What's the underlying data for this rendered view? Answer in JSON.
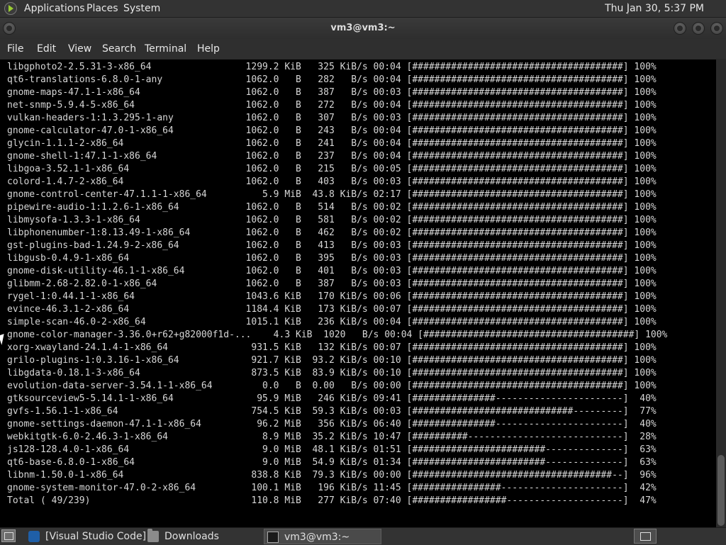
{
  "top_panel": {
    "logo_icon": "distro-logo-icon",
    "menus": [
      "Applications",
      "Places",
      "System"
    ],
    "clock": "Thu Jan 30,  5:37 PM"
  },
  "window": {
    "title": "vm3@vm3:~",
    "controls": [
      "minimize-icon",
      "maximize-icon",
      "close-icon"
    ]
  },
  "menubar": [
    "File",
    "Edit",
    "View",
    "Search",
    "Terminal",
    "Help"
  ],
  "terminal": {
    "lines": [
      "libgphoto2-2.5.31-3-x86_64                 1299.2 KiB   325 KiB/s 00:04 [######################################] 100%",
      "qt6-translations-6.8.0-1-any               1062.0   B   282   B/s 00:04 [######################################] 100%",
      "gnome-maps-47.1-1-x86_64                   1062.0   B   387   B/s 00:03 [######################################] 100%",
      "net-snmp-5.9.4-5-x86_64                    1062.0   B   272   B/s 00:04 [######################################] 100%",
      "vulkan-headers-1:1.3.295-1-any             1062.0   B   307   B/s 00:03 [######################################] 100%",
      "gnome-calculator-47.0-1-x86_64             1062.0   B   243   B/s 00:04 [######################################] 100%",
      "glycin-1.1.1-2-x86_64                      1062.0   B   241   B/s 00:04 [######################################] 100%",
      "gnome-shell-1:47.1-1-x86_64                1062.0   B   237   B/s 00:04 [######################################] 100%",
      "libgoa-3.52.1-1-x86_64                     1062.0   B   215   B/s 00:05 [######################################] 100%",
      "colord-1.4.7-2-x86_64                      1062.0   B   403   B/s 00:03 [######################################] 100%",
      "gnome-control-center-47.1.1-1-x86_64          5.9 MiB  43.8 KiB/s 02:17 [######################################] 100%",
      "pipewire-audio-1:1.2.6-1-x86_64            1062.0   B   514   B/s 00:02 [######################################] 100%",
      "libmysofa-1.3.3-1-x86_64                   1062.0   B   581   B/s 00:02 [######################################] 100%",
      "libphonenumber-1:8.13.49-1-x86_64          1062.0   B   462   B/s 00:02 [######################################] 100%",
      "gst-plugins-bad-1.24.9-2-x86_64            1062.0   B   413   B/s 00:03 [######################################] 100%",
      "libgusb-0.4.9-1-x86_64                     1062.0   B   395   B/s 00:03 [######################################] 100%",
      "gnome-disk-utility-46.1-1-x86_64           1062.0   B   401   B/s 00:03 [######################################] 100%",
      "glibmm-2.68-2.82.0-1-x86_64                1062.0   B   387   B/s 00:03 [######################################] 100%",
      "rygel-1:0.44.1-1-x86_64                    1043.6 KiB   170 KiB/s 00:06 [######################################] 100%",
      "evince-46.3.1-2-x86_64                     1184.4 KiB   173 KiB/s 00:07 [######################################] 100%",
      "simple-scan-46.0-2-x86_64                  1015.1 KiB   236 KiB/s 00:04 [######################################] 100%",
      "gnome-color-manager-3.36.0+r62+g82000f1d-...    4.3 KiB  1020   B/s 00:04 [######################################] 100%",
      "xorg-xwayland-24.1.4-1-x86_64               931.5 KiB   132 KiB/s 00:07 [######################################] 100%",
      "grilo-plugins-1:0.3.16-1-x86_64             921.7 KiB  93.2 KiB/s 00:10 [######################################] 100%",
      "libgdata-0.18.1-3-x86_64                    873.5 KiB  83.9 KiB/s 00:10 [######################################] 100%",
      "evolution-data-server-3.54.1-1-x86_64         0.0   B  0.00   B/s 00:00 [######################################] 100%",
      "gtksourceview5-5.14.1-1-x86_64               95.9 MiB   246 KiB/s 09:41 [###############-----------------------]  40%",
      "gvfs-1.56.1-1-x86_64                        754.5 KiB  59.3 KiB/s 00:03 [#############################---------]  77%",
      "gnome-settings-daemon-47.1-1-x86_64          96.2 MiB   356 KiB/s 06:40 [###############-----------------------]  40%",
      "webkitgtk-6.0-2.46.3-1-x86_64                 8.9 MiB  35.2 KiB/s 10:47 [##########----------------------------]  28%",
      "js128-128.4.0-1-x86_64                        9.0 MiB  48.1 KiB/s 01:51 [########################--------------]  63%",
      "qt6-base-6.8.0-1-x86_64                       9.0 MiB  54.9 KiB/s 01:34 [########################--------------]  63%",
      "libnm-1.50.0-1-x86_64                       838.8 KiB  79.3 KiB/s 00:00 [####################################--]  96%",
      "gnome-system-monitor-47.0-2-x86_64          100.1 MiB   196 KiB/s 11:45 [################----------------------]  42%",
      "Total ( 49/239)                             110.8 MiB   277 KiB/s 07:40 [#################---------------------]  47%"
    ]
  },
  "taskbar": {
    "show_desktop_icon": "show-desktop-icon",
    "tasks": [
      {
        "label": "[Visual Studio Code]",
        "icon": "vscode-icon"
      },
      {
        "label": "Downloads",
        "icon": "folder-icon"
      },
      {
        "label": "vm3@vm3:~",
        "icon": "terminal-icon"
      }
    ]
  }
}
